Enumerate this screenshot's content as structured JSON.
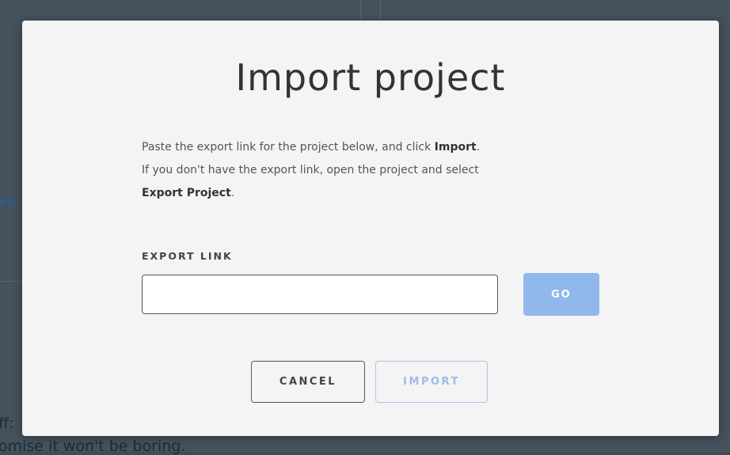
{
  "background": {
    "partial_heading": "PR",
    "partial_line_1": "ff:",
    "partial_line_2": "omise it won't be boring."
  },
  "modal": {
    "title": "Import project",
    "description": {
      "line1_prefix": "Paste the export link for the project below, and click ",
      "line1_bold": "Import",
      "line1_suffix": ".",
      "line2": "If you don't have the export link, open the project and select",
      "line3_bold": "Export Project",
      "line3_suffix": "."
    },
    "export_link": {
      "label": "EXPORT LINK",
      "value": "",
      "placeholder": ""
    },
    "go_label": "GO",
    "cancel_label": "CANCEL",
    "import_label": "IMPORT"
  },
  "colors": {
    "overlay": "#44525e",
    "modal_bg": "#f4f4f4",
    "go_button": "#90b8ec",
    "import_disabled": "#9dbbe6"
  }
}
